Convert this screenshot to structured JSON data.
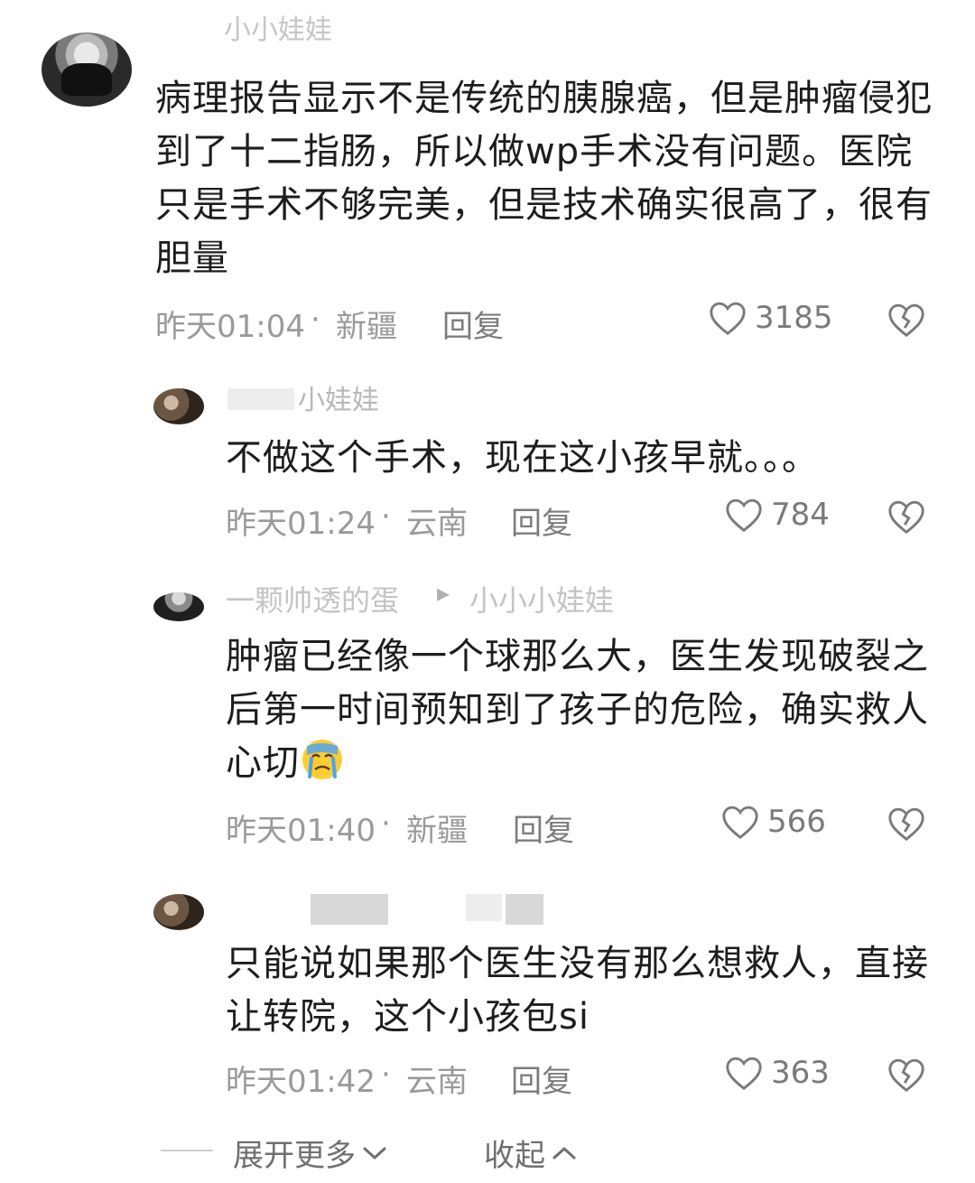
{
  "comments": [
    {
      "username": "小小娃娃",
      "text": "病理报告显示不是传统的胰腺癌，但是肿瘤侵犯到了十二指肠，所以做wp手术没有问题。医院只是手术不够完美，但是技术确实很高了，很有胆量",
      "time": "昨天01:04",
      "separator": "·",
      "location": "新疆",
      "reply_label": "回复",
      "likes": "3185"
    },
    {
      "username": "小娃娃",
      "text": "不做这个手术，现在这小孩早就。。。",
      "time": "昨天01:24",
      "separator": "·",
      "location": "云南",
      "reply_label": "回复",
      "likes": "784"
    },
    {
      "username": "一颗帅透的蛋",
      "reply_arrow": "▸",
      "reply_to": "小小小娃娃",
      "text": "肿瘤已经像一个球那么大，医生发现破裂之后第一时间预知到了孩子的危险，确实救人心切",
      "time": "昨天01:40",
      "separator": "·",
      "location": "新疆",
      "reply_label": "回复",
      "likes": "566"
    },
    {
      "username": "",
      "text": "只能说如果那个医生没有那么想救人，直接让转院，这个小孩包si",
      "time": "昨天01:42",
      "separator": "·",
      "location": "云南",
      "reply_label": "回复",
      "likes": "363"
    }
  ],
  "footer": {
    "expand_label": "展开更多",
    "collapse_label": "收起"
  },
  "icons": {
    "like": "heart-outline-icon",
    "dislike": "broken-heart-icon",
    "expand": "chevron-down-icon",
    "collapse": "chevron-up-icon",
    "emoji": "crying-face-emoji"
  },
  "colors": {
    "text": "#1d1d1d",
    "meta": "#9a9a9a",
    "icon": "#7a7a7a"
  }
}
